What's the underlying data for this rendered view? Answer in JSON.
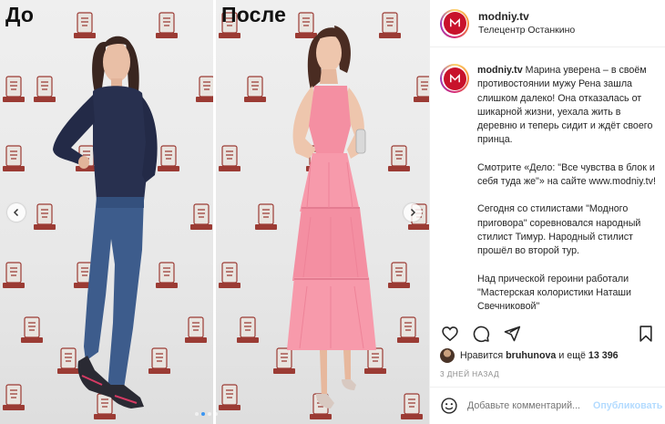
{
  "media": {
    "before_label": "До",
    "after_label": "После",
    "carousel": {
      "slides": 4,
      "active_index": 1
    },
    "icons": {
      "prev": "chevron-left-icon",
      "next": "chevron-right-icon"
    }
  },
  "post": {
    "username": "modniy.tv",
    "location": "Телецентр Останкино",
    "caption_username": "modniy.tv",
    "caption_paragraphs": [
      "Марина уверена – в своём противостоянии мужу Рена зашла слишком далеко! Она отказалась от шикарной жизни, уехала жить в деревню и теперь сидит и ждёт своего принца.",
      "Смотрите «Дело: \"Все чувства в блок и себя туда же\"» на сайте www.modniy.tv!",
      "Сегодня со стилистами \"Модного приговора\" соревновался народный стилист Тимур. Народный стилист прошёл во второй тур.",
      "Над прической героини работали \"Мастерская колористики Наташи Свечниковой\""
    ],
    "likes_prefix": "Нравится ",
    "likes_user": "bruhunova",
    "likes_and": " и ещё ",
    "likes_count": "13 396",
    "time_ago": "3 ДНЕЙ НАЗАД",
    "comment_placeholder": "Добавьте комментарий...",
    "publish_label": "Опубликовать"
  },
  "icons": {
    "like": "heart-icon",
    "comment": "comment-icon",
    "share": "share-icon",
    "save": "bookmark-icon",
    "emoji": "emoji-icon"
  },
  "colors": {
    "brand_avatar": "#c8122b",
    "publish_disabled": "#b3dbff",
    "carousel_active": "#3b96f2",
    "text": "#262626",
    "muted": "#8e8e8e"
  }
}
